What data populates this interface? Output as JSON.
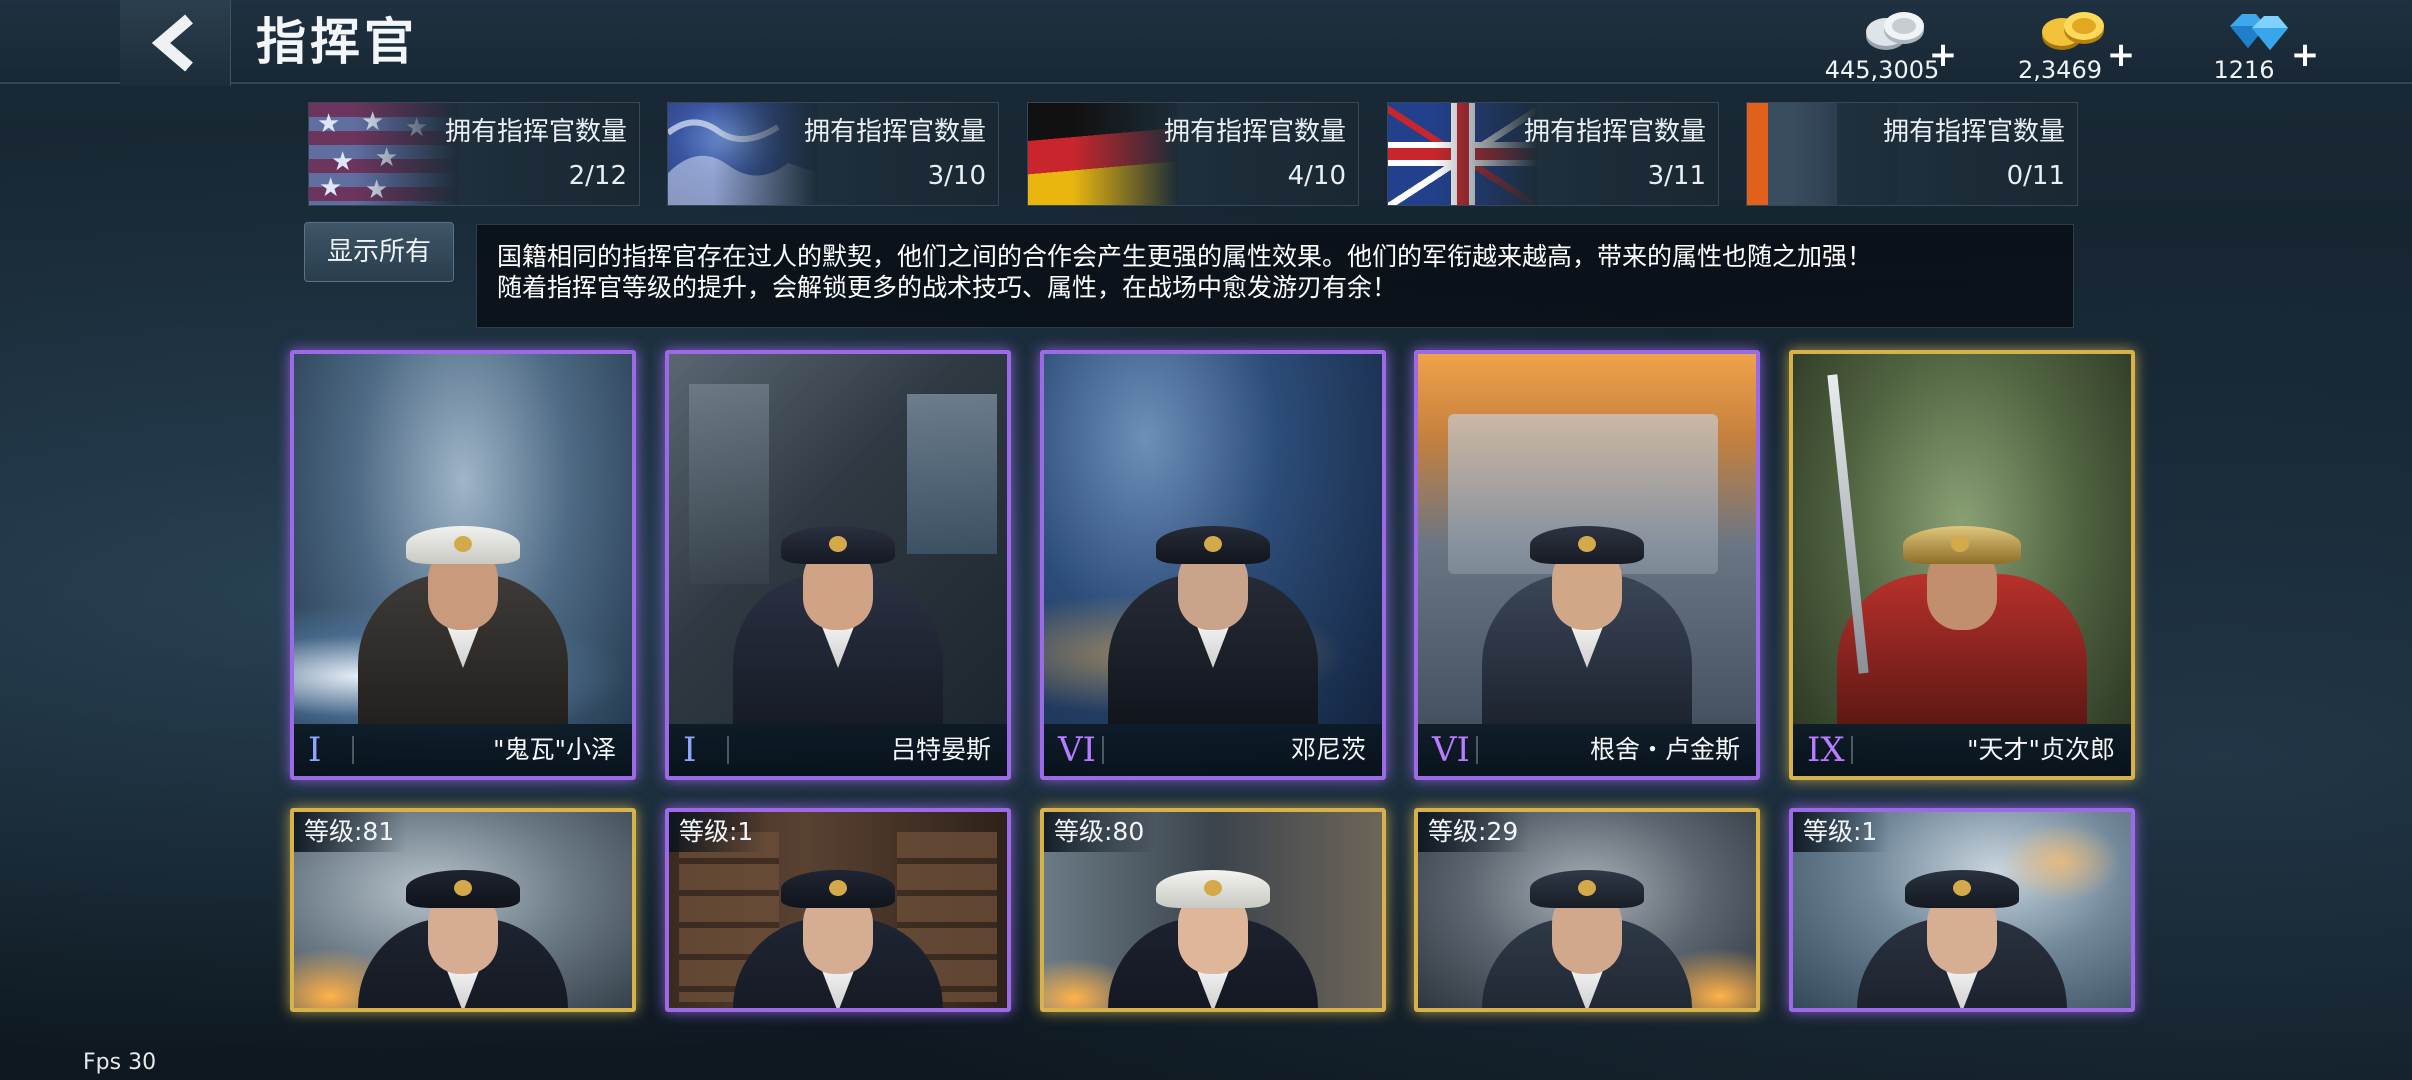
{
  "header": {
    "title": "指挥官",
    "currencies": [
      {
        "icon": "silver-coins-icon",
        "amount": "445,3005"
      },
      {
        "icon": "gold-coins-icon",
        "amount": "2,3469"
      },
      {
        "icon": "diamonds-icon",
        "amount": "1216"
      }
    ],
    "plus": "+"
  },
  "nation_tabs": [
    {
      "nation": "usa",
      "label": "拥有指挥官数量",
      "count": "2/12"
    },
    {
      "nation": "japan",
      "label": "拥有指挥官数量",
      "count": "3/10"
    },
    {
      "nation": "germany",
      "label": "拥有指挥官数量",
      "count": "4/10"
    },
    {
      "nation": "uk",
      "label": "拥有指挥官数量",
      "count": "3/11"
    },
    {
      "nation": "other",
      "label": "拥有指挥官数量",
      "count": "0/11"
    }
  ],
  "filter": {
    "show_all": "显示所有"
  },
  "description": {
    "line1": "国籍相同的指挥官存在过人的默契，他们之间的合作会产生更强的属性效果。他们的军衔越来越高，带来的属性也随之加强！",
    "line2": "随着指挥官等级的提升，会解锁更多的战术技巧、属性，在战场中愈发游刃有余！"
  },
  "commanders_row1": [
    {
      "rank": "I",
      "name": "\"鬼瓦\"小泽",
      "frame": "purple",
      "rank_color": "#8fa6ff"
    },
    {
      "rank": "I",
      "name": "吕特晏斯",
      "frame": "purple",
      "rank_color": "#8fa6ff"
    },
    {
      "rank": "VI",
      "name": "邓尼茨",
      "frame": "purple",
      "rank_color": "#b77cff"
    },
    {
      "rank": "VI",
      "name": "根舍・卢金斯",
      "frame": "purple",
      "rank_color": "#b77cff"
    },
    {
      "rank": "IX",
      "name": "\"天才\"贞次郎",
      "frame": "gold",
      "rank_color": "#b77cff"
    }
  ],
  "commanders_row2": [
    {
      "level": "等级:81",
      "frame": "gold"
    },
    {
      "level": "等级:1",
      "frame": "purple"
    },
    {
      "level": "等级:80",
      "frame": "gold"
    },
    {
      "level": "等级:29",
      "frame": "gold"
    },
    {
      "level": "等级:1",
      "frame": "purple"
    }
  ],
  "footer": {
    "fps": "Fps 30"
  }
}
